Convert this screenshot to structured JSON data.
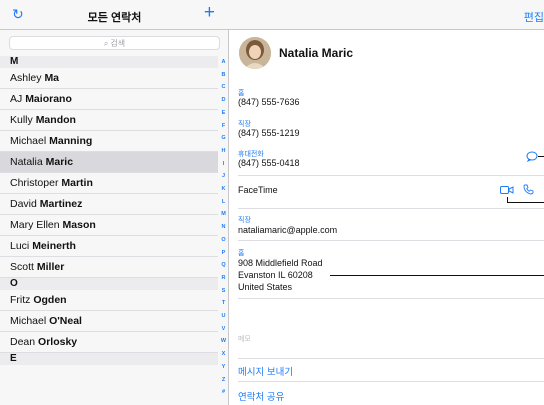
{
  "left_header": {
    "title": "모든 연락처",
    "refresh_icon": "refresh-icon",
    "add_icon": "plus-icon"
  },
  "search": {
    "placeholder": "검색"
  },
  "sections": [
    {
      "letter": "M",
      "contacts": [
        {
          "first": "Ashley",
          "last": "Ma"
        },
        {
          "first": "AJ",
          "last": "Maiorano"
        },
        {
          "first": "Kully",
          "last": "Mandon"
        },
        {
          "first": "Michael",
          "last": "Manning"
        },
        {
          "first": "Natalia",
          "last": "Maric",
          "selected": true
        },
        {
          "first": "Christoper",
          "last": "Martin"
        },
        {
          "first": "David",
          "last": "Martinez"
        },
        {
          "first": "Mary Ellen",
          "last": "Mason"
        },
        {
          "first": "Luci",
          "last": "Meinerth"
        },
        {
          "first": "Scott",
          "last": "Miller"
        }
      ]
    },
    {
      "letter": "O",
      "contacts": [
        {
          "first": "Fritz",
          "last": "Ogden"
        },
        {
          "first": "Michael",
          "last": "O'Neal"
        },
        {
          "first": "Dean",
          "last": "Orlosky"
        }
      ]
    },
    {
      "letter": "E",
      "contacts": []
    }
  ],
  "index_letters": [
    "A",
    "B",
    "C",
    "D",
    "E",
    "F",
    "G",
    "H",
    "I",
    "J",
    "K",
    "L",
    "M",
    "N",
    "O",
    "P",
    "Q",
    "R",
    "S",
    "T",
    "U",
    "V",
    "W",
    "X",
    "Y",
    "Z",
    "#"
  ],
  "right_header": {
    "edit_label": "편집"
  },
  "contact": {
    "name": "Natalia Maric",
    "home_label": "홈",
    "home_phone": "(847) 555-7636",
    "work_label": "직장",
    "work_phone": "(847) 555-1219",
    "mobile_label": "휴대전화",
    "mobile_phone": "(847) 555-0418",
    "facetime_label": "FaceTime",
    "email_label": "직장",
    "email": "nataliamaric@apple.com",
    "address_label": "홈",
    "address_line1": "908 Middlefield Road",
    "address_line2": "Evanston IL 60208",
    "address_line3": "United States",
    "memo_label": "메모"
  },
  "actions": {
    "send_message": "메시지 보내기",
    "share_contact": "연락처 공유"
  },
  "colors": {
    "accent": "#1f7cf6",
    "selected_row": "#d9d9dd"
  }
}
